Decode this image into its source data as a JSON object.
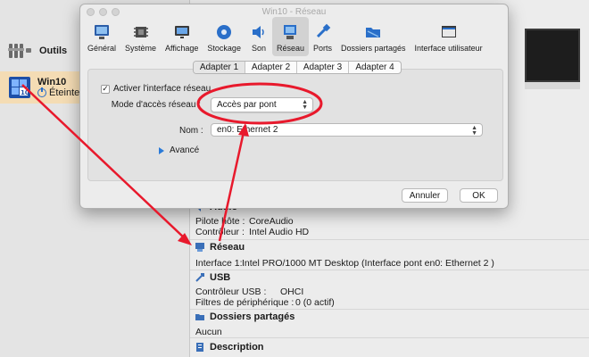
{
  "sidebar": {
    "tools_label": "Outils",
    "vm_name": "Win10",
    "vm_state": "Éteinte",
    "vm_badge": "64\n10"
  },
  "dialog": {
    "title": "Win10 - Réseau",
    "toolbar": [
      {
        "label": "Général",
        "icon": "monitor-icon"
      },
      {
        "label": "Système",
        "icon": "chip-icon"
      },
      {
        "label": "Affichage",
        "icon": "display-icon"
      },
      {
        "label": "Stockage",
        "icon": "disk-icon"
      },
      {
        "label": "Son",
        "icon": "speaker-icon"
      },
      {
        "label": "Réseau",
        "icon": "network-icon",
        "active": true
      },
      {
        "label": "Ports",
        "icon": "plug-icon"
      },
      {
        "label": "Dossiers partagés",
        "icon": "folder-icon"
      },
      {
        "label": "Interface utilisateur",
        "icon": "window-icon"
      }
    ],
    "tabs": [
      "Adapter 1",
      "Adapter 2",
      "Adapter 3",
      "Adapter 4"
    ],
    "active_tab": "Adapter 1",
    "enable_label": "Activer l'interface réseau",
    "enable_checked": "✓",
    "mode_label": "Mode d'accès réseau :",
    "mode_value": "Accès par pont",
    "name_label": "Nom :",
    "name_value": "en0: Ethernet 2",
    "advanced_label": "Avancé",
    "cancel_label": "Annuler",
    "ok_label": "OK"
  },
  "details": {
    "audio": {
      "title": "Audio",
      "host_driver_label": "Pilote hôte :",
      "host_driver_value": "CoreAudio",
      "controller_label": "Contrôleur :",
      "controller_value": "Intel Audio HD"
    },
    "network": {
      "title": "Réseau",
      "interface_label": "Interface 1:",
      "interface_value": "Intel PRO/1000 MT Desktop (Interface pont en0: Ethernet 2 )"
    },
    "usb": {
      "title": "USB",
      "controller_label": "Contrôleur USB :",
      "controller_value": "OHCI",
      "filters_label": "Filtres de périphérique :",
      "filters_value": "0 (0 actif)"
    },
    "shared": {
      "title": "Dossiers partagés",
      "value": "Aucun"
    },
    "description": {
      "title": "Description"
    }
  },
  "colors": {
    "annotation": "#e8192c",
    "selected_vm": "#f4dcb4",
    "accent": "#2a7ad8"
  }
}
